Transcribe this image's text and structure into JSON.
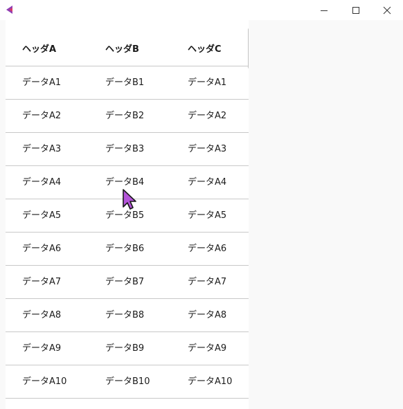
{
  "window": {
    "min_icon": "minimize-icon",
    "max_icon": "maximize-icon",
    "close_icon": "close-icon",
    "app_icon": "app-icon"
  },
  "table": {
    "headers": [
      "ヘッダA",
      "ヘッダB",
      "ヘッダC"
    ],
    "rows": [
      [
        "データA1",
        "データB1",
        "データA1"
      ],
      [
        "データA2",
        "データB2",
        "データA2"
      ],
      [
        "データA3",
        "データB3",
        "データA3"
      ],
      [
        "データA4",
        "データB4",
        "データA4"
      ],
      [
        "データA5",
        "データB5",
        "データA5"
      ],
      [
        "データA6",
        "データB6",
        "データA6"
      ],
      [
        "データA7",
        "データB7",
        "データA7"
      ],
      [
        "データA8",
        "データB8",
        "データA8"
      ],
      [
        "データA9",
        "データB9",
        "データA9"
      ],
      [
        "データA10",
        "データB10",
        "データA10"
      ]
    ]
  },
  "colors": {
    "app_icon_primary": "#8e3fb5",
    "app_icon_secondary": "#d83b6a",
    "cursor_fill": "#b455d9",
    "divider": "#c8c8c8",
    "scroll_thumb": "#c4c4c4"
  }
}
